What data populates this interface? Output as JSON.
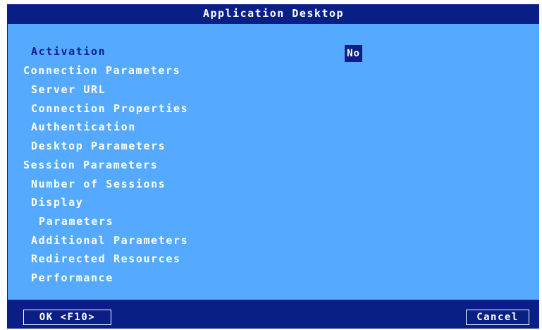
{
  "dialog": {
    "title": "Application Desktop",
    "activation_label": "Activation",
    "activation_value": "No",
    "items": [
      {
        "label": "Connection Parameters"
      },
      {
        "label": "Server URL"
      },
      {
        "label": "Connection Properties"
      },
      {
        "label": "Authentication"
      },
      {
        "label": "Desktop Parameters"
      },
      {
        "label": "Session Parameters"
      },
      {
        "label": "Number of Sessions"
      },
      {
        "label": "Display"
      },
      {
        "label": "Parameters"
      },
      {
        "label": "Additional Parameters"
      },
      {
        "label": "Redirected Resources"
      },
      {
        "label": "Performance"
      }
    ]
  },
  "footer": {
    "ok_label": "OK <F10>",
    "cancel_label": "Cancel"
  },
  "colors": {
    "background": "#55aaff",
    "titlebar": "#0a1f86",
    "text": "#ffffff",
    "active_text": "#0a1f86"
  }
}
